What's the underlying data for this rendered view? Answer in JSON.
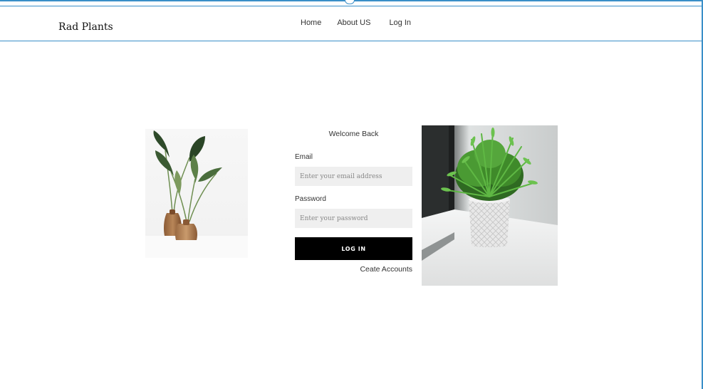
{
  "header": {
    "brand": "Rad Plants",
    "nav": {
      "home": "Home",
      "about": "About US",
      "login": "Log In"
    }
  },
  "login_form": {
    "heading": "Welcome Back",
    "email_label": "Email",
    "email_placeholder": "Enter your email address",
    "password_label": "Password",
    "password_placeholder": "Enter your password",
    "submit_label": "LOG IN",
    "create_account_link": "Ceate Accounts"
  },
  "colors": {
    "accent_border": "#3a8fc8",
    "button_bg": "#000000",
    "field_bg": "#efefef"
  }
}
